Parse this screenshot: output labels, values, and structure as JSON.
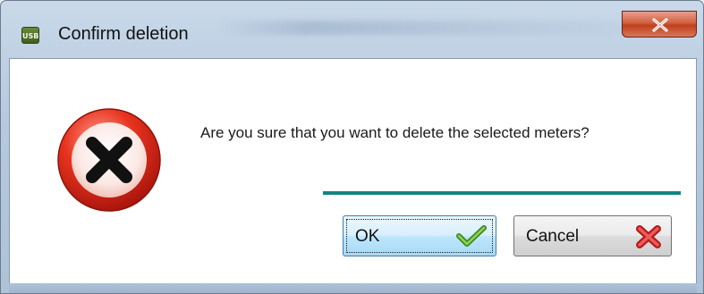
{
  "window": {
    "title": "Confirm deletion",
    "app_icon_text": "USB",
    "app_icon_name": "app-icon",
    "close_icon_name": "close-icon"
  },
  "dialog": {
    "icon_name": "error-icon",
    "message": "Are you sure that you want to delete the selected meters?",
    "accent_line_color": "#13857f"
  },
  "buttons": {
    "ok_label": "OK",
    "ok_icon_name": "checkmark-icon",
    "cancel_label": "Cancel",
    "cancel_icon_name": "red-x-icon"
  }
}
